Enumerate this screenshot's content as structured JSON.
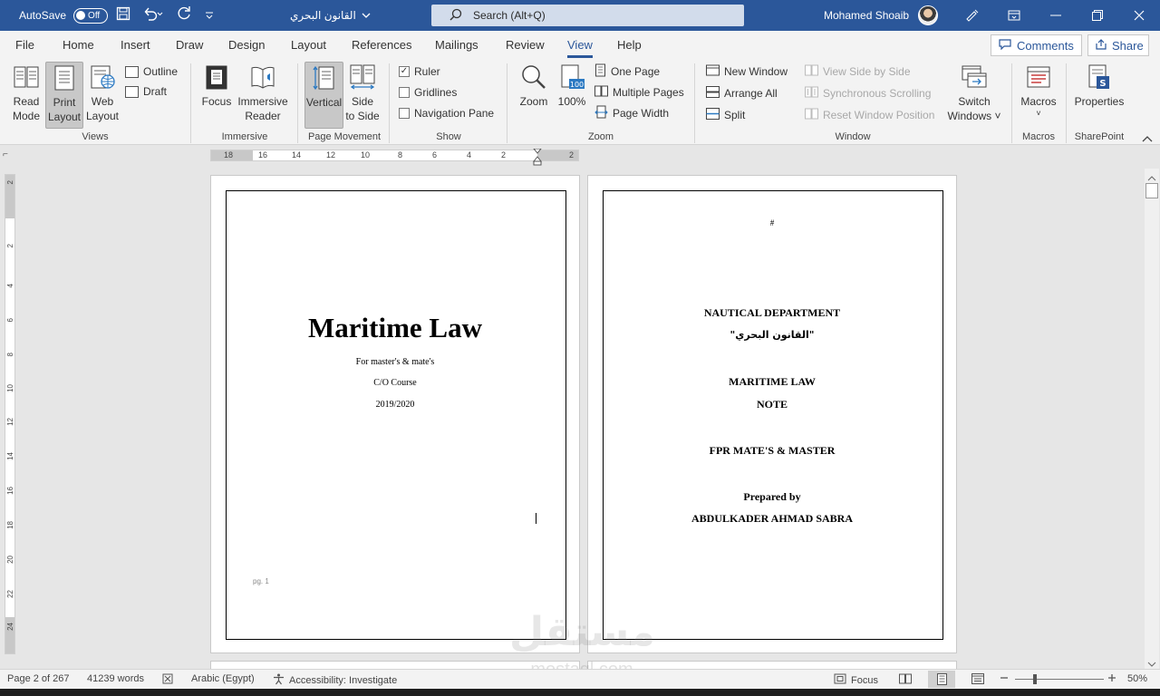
{
  "titlebar": {
    "autosave_label": "AutoSave",
    "autosave_state": "Off",
    "doc_title": "القانون البحري",
    "search_placeholder": "Search (Alt+Q)",
    "user_name": "Mohamed Shoaib"
  },
  "tabs": [
    "File",
    "Home",
    "Insert",
    "Draw",
    "Design",
    "Layout",
    "References",
    "Mailings",
    "Review",
    "View",
    "Help"
  ],
  "active_tab": "View",
  "top_buttons": {
    "comments": "Comments",
    "share": "Share"
  },
  "ribbon": {
    "views": {
      "label": "Views",
      "read_mode": [
        "Read",
        "Mode"
      ],
      "print_layout": [
        "Print",
        "Layout"
      ],
      "web_layout": [
        "Web",
        "Layout"
      ],
      "outline": "Outline",
      "draft": "Draft"
    },
    "immersive": {
      "label": "Immersive",
      "focus": "Focus",
      "immersive_reader": [
        "Immersive",
        "Reader"
      ]
    },
    "page_movement": {
      "label": "Page Movement",
      "vertical": "Vertical",
      "side_to_side": [
        "Side",
        "to Side"
      ]
    },
    "show": {
      "label": "Show",
      "ruler": "Ruler",
      "gridlines": "Gridlines",
      "navigation_pane": "Navigation Pane"
    },
    "zoom": {
      "label": "Zoom",
      "zoom": "Zoom",
      "hundred": "100%",
      "one_page": "One Page",
      "multiple_pages": "Multiple Pages",
      "page_width": "Page Width"
    },
    "window": {
      "label": "Window",
      "new_window": "New Window",
      "arrange_all": "Arrange All",
      "split": "Split",
      "view_side_by_side": "View Side by Side",
      "synchronous_scrolling": "Synchronous Scrolling",
      "reset_window_position": "Reset Window Position",
      "switch_windows": [
        "Switch",
        "Windows ˅"
      ]
    },
    "macros": {
      "label": "Macros",
      "macros": "Macros"
    },
    "sharepoint": {
      "label": "SharePoint",
      "properties": "Properties"
    }
  },
  "ruler_numbers": [
    "18",
    "16",
    "14",
    "12",
    "10",
    "8",
    "6",
    "4",
    "2",
    "2"
  ],
  "vruler_numbers": [
    "2",
    "2",
    "4",
    "6",
    "8",
    "10",
    "12",
    "14",
    "16",
    "18",
    "20",
    "22",
    "24"
  ],
  "page1": {
    "title": "Maritime Law",
    "subtitle": "For master's & mate's",
    "course": "C/O Course",
    "year": "2019/2020",
    "footer": "pg. 1"
  },
  "page2": {
    "hash": "#",
    "department": "NAUTICAL DEPARTMENT",
    "arabic_title": "\"القانون البحري\"",
    "maritime_law": "MARITIME LAW",
    "note": "NOTE",
    "audience": "FPR MATE'S & MASTER",
    "prepared_by": "Prepared by",
    "author": "ABDULKADER AHMAD SABRA"
  },
  "status": {
    "page": "Page 2 of 267",
    "words": "41239 words",
    "language": "Arabic (Egypt)",
    "accessibility": "Accessibility: Investigate",
    "focus": "Focus",
    "zoom": "50%"
  },
  "watermark": {
    "arabic": "مستقل",
    "latin": "mostaql.com"
  },
  "colors": {
    "accent": "#2b579a",
    "ribbon_bg": "#f3f3f3",
    "canvas_bg": "#e6e6e6"
  }
}
